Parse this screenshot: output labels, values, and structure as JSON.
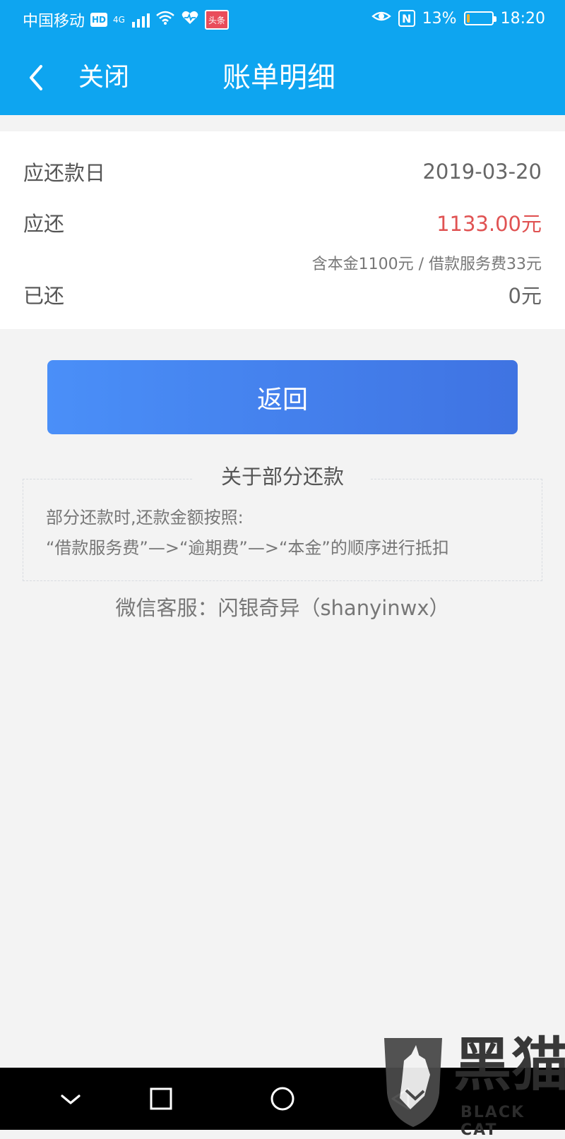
{
  "status_bar": {
    "carrier": "中国移动",
    "network": "4G",
    "badge_hd": "HD",
    "badge_app": "头条",
    "battery_percent": "13%",
    "battery_level": 0.13,
    "time": "18:20",
    "nfc": "N"
  },
  "header": {
    "close_label": "关闭",
    "title": "账单明细"
  },
  "bill": {
    "due_date_label": "应还款日",
    "due_date_value": "2019-03-20",
    "due_amount_label": "应还",
    "due_amount_value": "1133.00元",
    "breakdown": "含本金1100元 / 借款服务费33元",
    "paid_label": "已还",
    "paid_value": "0元"
  },
  "actions": {
    "return_label": "返回"
  },
  "notice": {
    "title": "关于部分还款",
    "line1": "部分还款时,还款金额按照:",
    "line2": "“借款服务费”—>“逾期费”—>“本金”的顺序进行抵扣",
    "service": "微信客服：闪银奇异（shanyinwx）"
  },
  "watermark": {
    "brand_cn": "黑猫",
    "brand_en": "BLACK CAT"
  },
  "colors": {
    "header_blue": "#0ea5f0",
    "button_blue": "#4a8ff8",
    "amount_red": "#e05353",
    "background_gray": "#f3f3f3"
  },
  "icons": {
    "back": "chevron-left-icon",
    "signal": "signal-icon",
    "wifi": "wifi-icon",
    "heart": "heart-rate-icon",
    "eye": "eye-icon",
    "battery": "battery-icon",
    "nav_down": "chevron-down-icon",
    "nav_recent": "square-icon",
    "nav_home": "circle-icon",
    "nav_back": "triangle-back-icon"
  }
}
